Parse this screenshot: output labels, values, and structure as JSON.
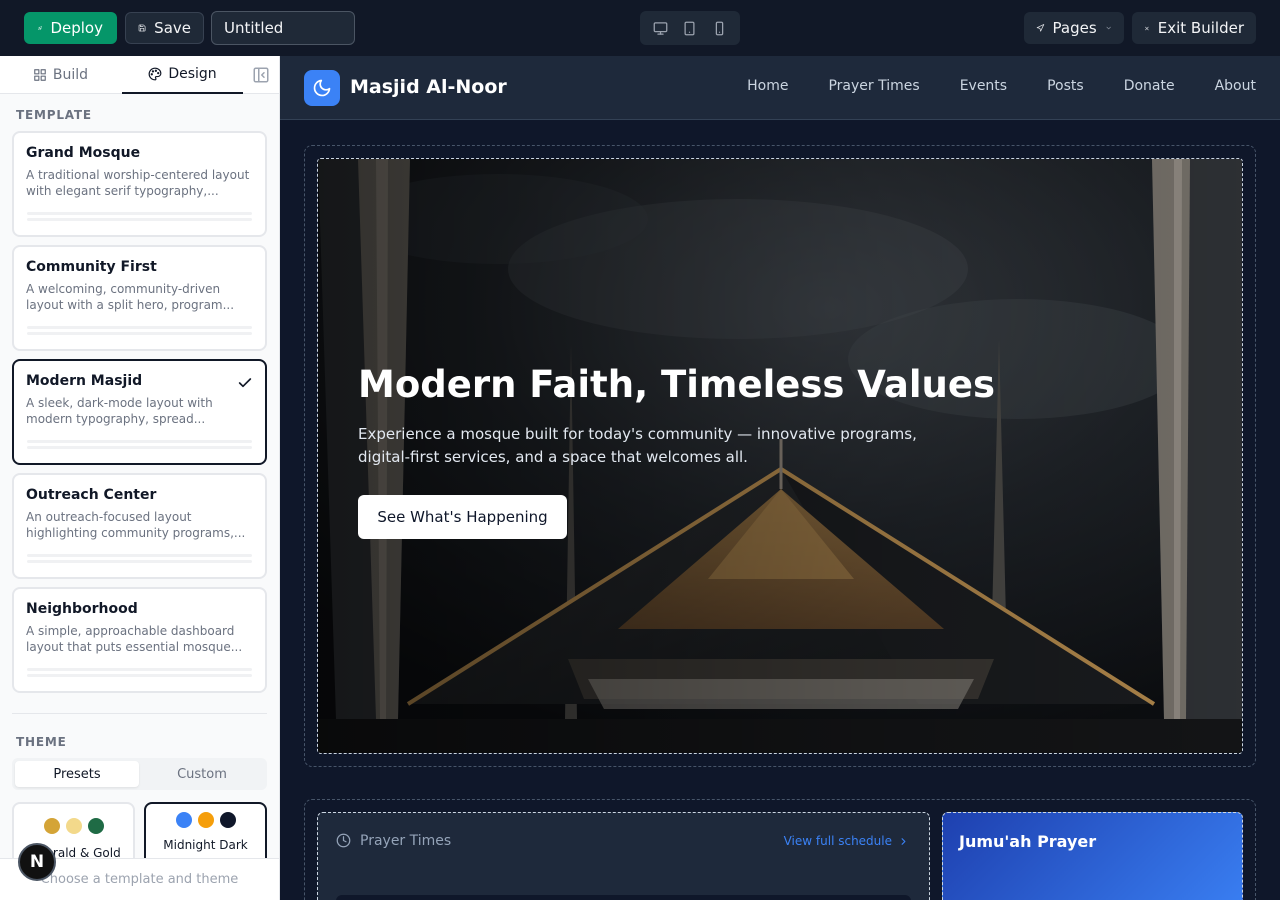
{
  "toolbar": {
    "deploy_label": "Deploy",
    "save_label": "Save",
    "title_value": "Untitled",
    "devices": [
      "desktop-icon",
      "tablet-icon",
      "mobile-icon"
    ],
    "pages_label": "Pages",
    "exit_label": "Exit Builder"
  },
  "sidebar": {
    "tabs": {
      "build": "Build",
      "design": "Design",
      "active": "Design"
    },
    "template_heading": "TEMPLATE",
    "templates": [
      {
        "name": "Grand Mosque",
        "desc": "A traditional worship-centered layout with elegant serif typography,...",
        "selected": false
      },
      {
        "name": "Community First",
        "desc": "A welcoming, community-driven layout with a split hero, program...",
        "selected": false
      },
      {
        "name": "Modern Masjid",
        "desc": "A sleek, dark-mode layout with modern typography, spread...",
        "selected": true
      },
      {
        "name": "Outreach Center",
        "desc": "An outreach-focused layout highlighting community programs,...",
        "selected": false
      },
      {
        "name": "Neighborhood",
        "desc": "A simple, approachable dashboard layout that puts essential mosque...",
        "selected": false
      }
    ],
    "theme_heading": "THEME",
    "theme_tabs": {
      "presets": "Presets",
      "custom": "Custom",
      "active": "Presets"
    },
    "presets": [
      {
        "name": "Emerald & Gold",
        "colors": [
          "#d4a437",
          "#f3d98b",
          "#1f6b45"
        ],
        "selected": false
      },
      {
        "name": "Midnight Dark",
        "colors": [
          "#3b82f6",
          "#f59e0b",
          "#0f172a"
        ],
        "selected": true
      }
    ],
    "footer_hint": "Choose a template and theme",
    "badge_letter": "N"
  },
  "site": {
    "name": "Masjid Al-Noor",
    "logo_icon": "moon-icon",
    "nav": [
      "Home",
      "Prayer Times",
      "Events",
      "Posts",
      "Donate",
      "About"
    ],
    "hero": {
      "title": "Modern Faith, Timeless Values",
      "subtitle": "Experience a mosque built for today's community — innovative programs, digital-first services, and a space that welcomes all.",
      "cta": "See What's Happening"
    },
    "prayer": {
      "title": "Prayer Times",
      "link": "View full schedule"
    },
    "jumuah": {
      "title": "Jumu'ah Prayer"
    }
  },
  "colors": {
    "accent_green": "#059669",
    "accent_blue": "#3b82f6",
    "canvas_dark": "#0f172a",
    "panel_dark": "#1e293b"
  }
}
